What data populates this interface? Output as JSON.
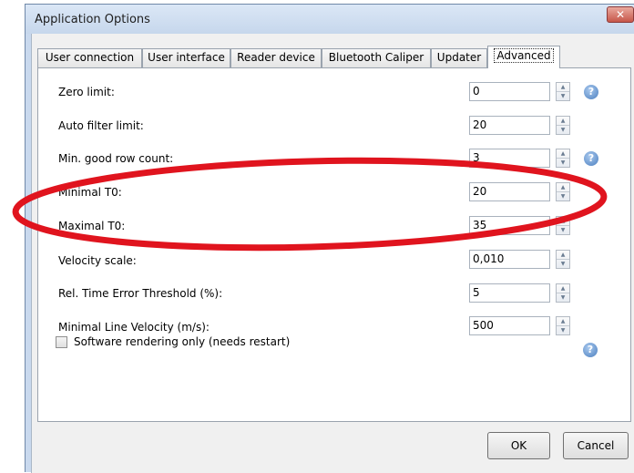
{
  "window": {
    "title": "Application Options",
    "close_symbol": "✕"
  },
  "tabs": [
    {
      "label": "User connection"
    },
    {
      "label": "User interface"
    },
    {
      "label": "Reader device"
    },
    {
      "label": "Bluetooth Caliper"
    },
    {
      "label": "Updater"
    },
    {
      "label": "Advanced",
      "active": true
    }
  ],
  "settings": [
    {
      "label": "Zero limit:",
      "value": "0",
      "help": true
    },
    {
      "label": "Auto filter limit:",
      "value": "20",
      "help": false
    },
    {
      "label": "Min. good row count:",
      "value": "3",
      "help": true
    },
    {
      "label": "Minimal T0:",
      "value": "20",
      "help": false
    },
    {
      "label": "Maximal T0:",
      "value": "35",
      "help": false
    },
    {
      "label": "Velocity scale:",
      "value": "0,010",
      "help": false
    },
    {
      "label": "Rel. Time Error Threshold (%):",
      "value": "5",
      "help": false
    },
    {
      "label": "Minimal Line Velocity (m/s):",
      "value": "500",
      "help": false
    }
  ],
  "software_rendering": {
    "label": "Software rendering only (needs restart)",
    "checked": false,
    "help": true
  },
  "help_symbol": "?",
  "spin_up": "▲",
  "spin_down": "▼",
  "buttons": {
    "ok": "OK",
    "cancel": "Cancel"
  },
  "annotation": {
    "shape": "ellipse",
    "color": "#e0141e",
    "highlights": [
      "Minimal T0:",
      "Maximal T0:"
    ]
  }
}
